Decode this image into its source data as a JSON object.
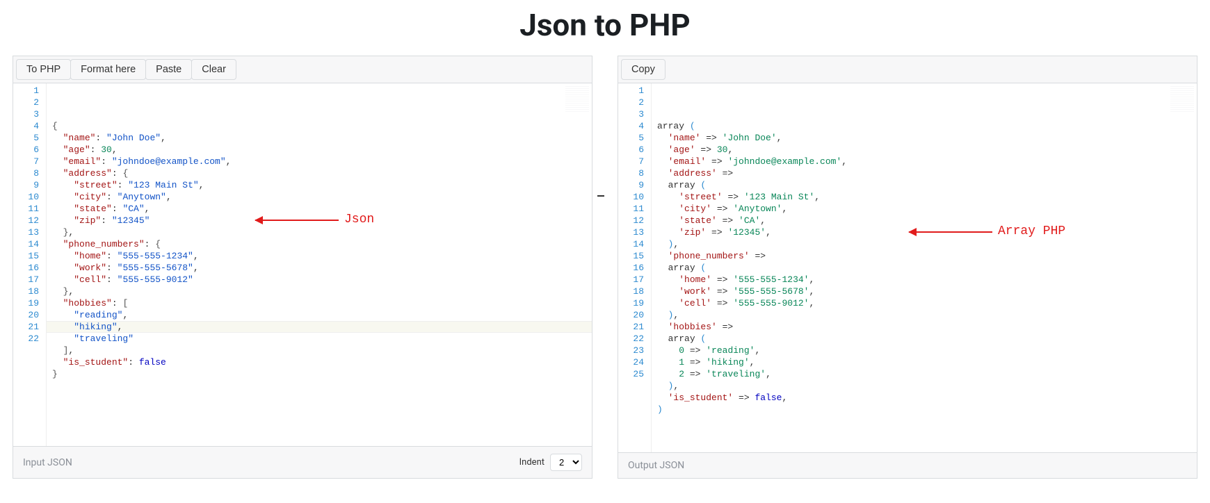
{
  "title": "Json to PHP",
  "left": {
    "buttons": {
      "to_php": "To PHP",
      "format": "Format here",
      "paste": "Paste",
      "clear": "Clear"
    },
    "footer_label": "Input JSON",
    "indent_label": "Indent",
    "indent_value": "2",
    "highlight_line_index": 20,
    "lines": [
      [
        [
          "brace",
          "{"
        ]
      ],
      [
        [
          "indent",
          "  "
        ],
        [
          "key",
          "\"name\""
        ],
        [
          "punct",
          ": "
        ],
        [
          "str",
          "\"John Doe\""
        ],
        [
          "punct",
          ","
        ]
      ],
      [
        [
          "indent",
          "  "
        ],
        [
          "key",
          "\"age\""
        ],
        [
          "punct",
          ": "
        ],
        [
          "num",
          "30"
        ],
        [
          "punct",
          ","
        ]
      ],
      [
        [
          "indent",
          "  "
        ],
        [
          "key",
          "\"email\""
        ],
        [
          "punct",
          ": "
        ],
        [
          "str",
          "\"johndoe@example.com\""
        ],
        [
          "punct",
          ","
        ]
      ],
      [
        [
          "indent",
          "  "
        ],
        [
          "key",
          "\"address\""
        ],
        [
          "punct",
          ": "
        ],
        [
          "brace",
          "{"
        ]
      ],
      [
        [
          "indent",
          "    "
        ],
        [
          "key",
          "\"street\""
        ],
        [
          "punct",
          ": "
        ],
        [
          "str",
          "\"123 Main St\""
        ],
        [
          "punct",
          ","
        ]
      ],
      [
        [
          "indent",
          "    "
        ],
        [
          "key",
          "\"city\""
        ],
        [
          "punct",
          ": "
        ],
        [
          "str",
          "\"Anytown\""
        ],
        [
          "punct",
          ","
        ]
      ],
      [
        [
          "indent",
          "    "
        ],
        [
          "key",
          "\"state\""
        ],
        [
          "punct",
          ": "
        ],
        [
          "str",
          "\"CA\""
        ],
        [
          "punct",
          ","
        ]
      ],
      [
        [
          "indent",
          "    "
        ],
        [
          "key",
          "\"zip\""
        ],
        [
          "punct",
          ": "
        ],
        [
          "str",
          "\"12345\""
        ]
      ],
      [
        [
          "indent",
          "  "
        ],
        [
          "brace",
          "}"
        ],
        [
          "punct",
          ","
        ]
      ],
      [
        [
          "indent",
          "  "
        ],
        [
          "key",
          "\"phone_numbers\""
        ],
        [
          "punct",
          ": "
        ],
        [
          "brace",
          "{"
        ]
      ],
      [
        [
          "indent",
          "    "
        ],
        [
          "key",
          "\"home\""
        ],
        [
          "punct",
          ": "
        ],
        [
          "str",
          "\"555-555-1234\""
        ],
        [
          "punct",
          ","
        ]
      ],
      [
        [
          "indent",
          "    "
        ],
        [
          "key",
          "\"work\""
        ],
        [
          "punct",
          ": "
        ],
        [
          "str",
          "\"555-555-5678\""
        ],
        [
          "punct",
          ","
        ]
      ],
      [
        [
          "indent",
          "    "
        ],
        [
          "key",
          "\"cell\""
        ],
        [
          "punct",
          ": "
        ],
        [
          "str",
          "\"555-555-9012\""
        ]
      ],
      [
        [
          "indent",
          "  "
        ],
        [
          "brace",
          "}"
        ],
        [
          "punct",
          ","
        ]
      ],
      [
        [
          "indent",
          "  "
        ],
        [
          "key",
          "\"hobbies\""
        ],
        [
          "punct",
          ": "
        ],
        [
          "brace",
          "["
        ]
      ],
      [
        [
          "indent",
          "    "
        ],
        [
          "str",
          "\"reading\""
        ],
        [
          "punct",
          ","
        ]
      ],
      [
        [
          "indent",
          "    "
        ],
        [
          "str",
          "\"hiking\""
        ],
        [
          "punct",
          ","
        ]
      ],
      [
        [
          "indent",
          "    "
        ],
        [
          "str",
          "\"traveling\""
        ]
      ],
      [
        [
          "indent",
          "  "
        ],
        [
          "brace",
          "]"
        ],
        [
          "punct",
          ","
        ]
      ],
      [
        [
          "indent",
          "  "
        ],
        [
          "key",
          "\"is_student\""
        ],
        [
          "punct",
          ": "
        ],
        [
          "bool",
          "false"
        ]
      ],
      [
        [
          "brace",
          "}"
        ]
      ]
    ],
    "annotation": "Json"
  },
  "right": {
    "buttons": {
      "copy": "Copy"
    },
    "footer_label": "Output JSON",
    "lines": [
      [
        [
          "arrkw",
          "array "
        ],
        [
          "paren",
          "("
        ]
      ],
      [
        [
          "indent",
          "  "
        ],
        [
          "key",
          "'name'"
        ],
        [
          "arrow",
          " => "
        ],
        [
          "str",
          "'John Doe'"
        ],
        [
          "punct",
          ","
        ]
      ],
      [
        [
          "indent",
          "  "
        ],
        [
          "key",
          "'age'"
        ],
        [
          "arrow",
          " => "
        ],
        [
          "num",
          "30"
        ],
        [
          "punct",
          ","
        ]
      ],
      [
        [
          "indent",
          "  "
        ],
        [
          "key",
          "'email'"
        ],
        [
          "arrow",
          " => "
        ],
        [
          "str",
          "'johndoe@example.com'"
        ],
        [
          "punct",
          ","
        ]
      ],
      [
        [
          "indent",
          "  "
        ],
        [
          "key",
          "'address'"
        ],
        [
          "arrow",
          " =>"
        ]
      ],
      [
        [
          "indent",
          "  "
        ],
        [
          "arrkw",
          "array "
        ],
        [
          "paren",
          "("
        ]
      ],
      [
        [
          "indent",
          "    "
        ],
        [
          "key",
          "'street'"
        ],
        [
          "arrow",
          " => "
        ],
        [
          "str",
          "'123 Main St'"
        ],
        [
          "punct",
          ","
        ]
      ],
      [
        [
          "indent",
          "    "
        ],
        [
          "key",
          "'city'"
        ],
        [
          "arrow",
          " => "
        ],
        [
          "str",
          "'Anytown'"
        ],
        [
          "punct",
          ","
        ]
      ],
      [
        [
          "indent",
          "    "
        ],
        [
          "key",
          "'state'"
        ],
        [
          "arrow",
          " => "
        ],
        [
          "str",
          "'CA'"
        ],
        [
          "punct",
          ","
        ]
      ],
      [
        [
          "indent",
          "    "
        ],
        [
          "key",
          "'zip'"
        ],
        [
          "arrow",
          " => "
        ],
        [
          "str",
          "'12345'"
        ],
        [
          "punct",
          ","
        ]
      ],
      [
        [
          "indent",
          "  "
        ],
        [
          "paren",
          ")"
        ],
        [
          "punct",
          ","
        ]
      ],
      [
        [
          "indent",
          "  "
        ],
        [
          "key",
          "'phone_numbers'"
        ],
        [
          "arrow",
          " =>"
        ]
      ],
      [
        [
          "indent",
          "  "
        ],
        [
          "arrkw",
          "array "
        ],
        [
          "paren",
          "("
        ]
      ],
      [
        [
          "indent",
          "    "
        ],
        [
          "key",
          "'home'"
        ],
        [
          "arrow",
          " => "
        ],
        [
          "str",
          "'555-555-1234'"
        ],
        [
          "punct",
          ","
        ]
      ],
      [
        [
          "indent",
          "    "
        ],
        [
          "key",
          "'work'"
        ],
        [
          "arrow",
          " => "
        ],
        [
          "str",
          "'555-555-5678'"
        ],
        [
          "punct",
          ","
        ]
      ],
      [
        [
          "indent",
          "    "
        ],
        [
          "key",
          "'cell'"
        ],
        [
          "arrow",
          " => "
        ],
        [
          "str",
          "'555-555-9012'"
        ],
        [
          "punct",
          ","
        ]
      ],
      [
        [
          "indent",
          "  "
        ],
        [
          "paren",
          ")"
        ],
        [
          "punct",
          ","
        ]
      ],
      [
        [
          "indent",
          "  "
        ],
        [
          "key",
          "'hobbies'"
        ],
        [
          "arrow",
          " =>"
        ]
      ],
      [
        [
          "indent",
          "  "
        ],
        [
          "arrkw",
          "array "
        ],
        [
          "paren",
          "("
        ]
      ],
      [
        [
          "indent",
          "    "
        ],
        [
          "num",
          "0"
        ],
        [
          "arrow",
          " => "
        ],
        [
          "str",
          "'reading'"
        ],
        [
          "punct",
          ","
        ]
      ],
      [
        [
          "indent",
          "    "
        ],
        [
          "num",
          "1"
        ],
        [
          "arrow",
          " => "
        ],
        [
          "str",
          "'hiking'"
        ],
        [
          "punct",
          ","
        ]
      ],
      [
        [
          "indent",
          "    "
        ],
        [
          "num",
          "2"
        ],
        [
          "arrow",
          " => "
        ],
        [
          "str",
          "'traveling'"
        ],
        [
          "punct",
          ","
        ]
      ],
      [
        [
          "indent",
          "  "
        ],
        [
          "paren",
          ")"
        ],
        [
          "punct",
          ","
        ]
      ],
      [
        [
          "indent",
          "  "
        ],
        [
          "key",
          "'is_student'"
        ],
        [
          "arrow",
          " => "
        ],
        [
          "bool",
          "false"
        ],
        [
          "punct",
          ","
        ]
      ],
      [
        [
          "paren",
          ")"
        ]
      ]
    ],
    "annotation": "Array PHP"
  }
}
